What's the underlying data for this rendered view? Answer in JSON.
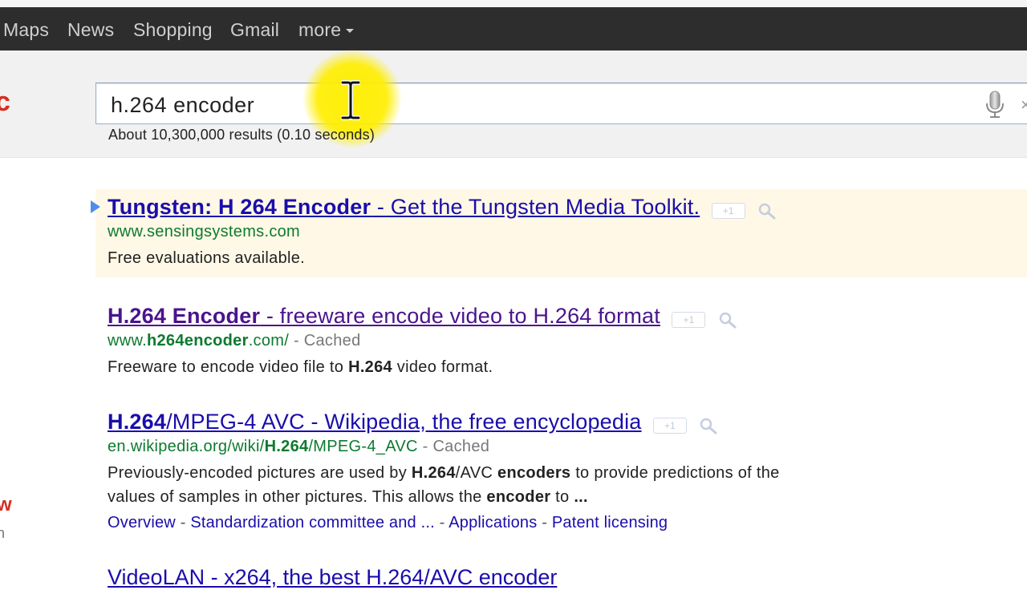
{
  "topbar": {
    "items": [
      "Maps",
      "News",
      "Shopping",
      "Gmail"
    ],
    "more_label": "more"
  },
  "logo_fragment": "c",
  "search": {
    "value": "h.264 encoder"
  },
  "stats": "About 10,300,000 results (0.10 seconds)",
  "results": [
    {
      "title_bold": "Tungsten: H 264 Encoder",
      "title_rest": " - Get the Tungsten Media Toolkit.",
      "url": "www.sensingsystems.com",
      "snippet": "Free evaluations available."
    },
    {
      "title_bold": "H.264 Encoder",
      "title_rest": " - freeware encode video to H.264 format",
      "url_pre": "www.",
      "url_bold": "h264encoder",
      "url_post": ".com/",
      "cached": " - Cached",
      "snippet_pre": "Freeware to encode video file to ",
      "snippet_bold": "H.264",
      "snippet_post": " video format."
    },
    {
      "title_bold": "H.264",
      "title_rest": "/MPEG-4 AVC - Wikipedia, the free encyclopedia",
      "url_pre": "en.wikipedia.org/wiki/",
      "url_bold": "H.264",
      "url_post": "/MPEG-4_AVC",
      "cached": " - Cached",
      "snippet_line1_a": "Previously-encoded pictures are used by ",
      "snippet_line1_b": "H.264",
      "snippet_line1_c": "/AVC ",
      "snippet_line1_d": "encoders",
      "snippet_line1_e": " to provide predictions of the",
      "snippet_line2_a": "values of samples in other pictures. This allows the ",
      "snippet_line2_b": "encoder",
      "snippet_line2_c": " to ",
      "snippet_line2_d": "...",
      "sublinks": [
        "Overview",
        "Standardization committee and ...",
        "Applications",
        "Patent licensing"
      ]
    }
  ],
  "plus_one_label": "+1",
  "left_fragment_1": "w",
  "left_fragment_2": "n",
  "cutoff_title": "VideoLAN - x264, the best H.264/AVC encoder"
}
